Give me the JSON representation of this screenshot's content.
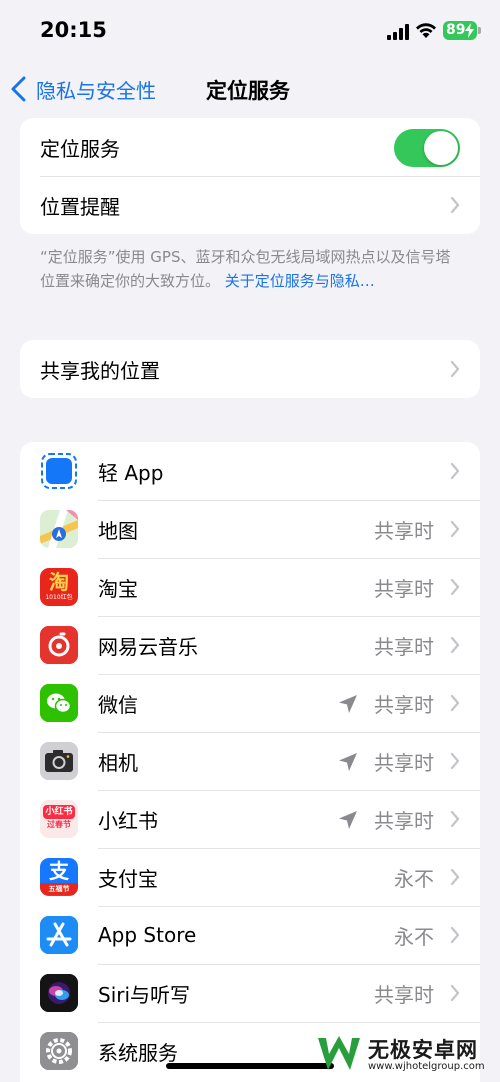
{
  "status_bar": {
    "time": "20:15",
    "battery": "89"
  },
  "nav": {
    "back_label": "隐私与安全性",
    "title": "定位服务"
  },
  "section_main": {
    "location_services_label": "定位服务",
    "location_services_on": true,
    "location_alerts_label": "位置提醒"
  },
  "footer": {
    "text": "“定位服务”使用 GPS、蓝牙和众包无线局域网热点以及信号塔位置来确定你的大致方位。",
    "link": "关于定位服务与隐私…"
  },
  "share_location_label": "共享我的位置",
  "apps": [
    {
      "name": "轻 App",
      "value": "",
      "arrow": false,
      "icon": "app-clip-icon"
    },
    {
      "name": "地图",
      "value": "共享时",
      "arrow": false,
      "icon": "maps-icon"
    },
    {
      "name": "淘宝",
      "value": "共享时",
      "arrow": false,
      "icon": "taobao-icon"
    },
    {
      "name": "网易云音乐",
      "value": "共享时",
      "arrow": false,
      "icon": "netease-music-icon"
    },
    {
      "name": "微信",
      "value": "共享时",
      "arrow": true,
      "icon": "wechat-icon"
    },
    {
      "name": "相机",
      "value": "共享时",
      "arrow": true,
      "icon": "camera-icon"
    },
    {
      "name": "小红书",
      "value": "共享时",
      "arrow": true,
      "icon": "xiaohongshu-icon"
    },
    {
      "name": "支付宝",
      "value": "永不",
      "arrow": false,
      "icon": "alipay-icon"
    },
    {
      "name": "App Store",
      "value": "永不",
      "arrow": false,
      "icon": "app-store-icon"
    },
    {
      "name": "Siri与听写",
      "value": "共享时",
      "arrow": false,
      "icon": "siri-icon"
    },
    {
      "name": "系统服务",
      "value": "",
      "arrow": false,
      "icon": "settings-gear-icon"
    }
  ],
  "icon_texts": {
    "taobao": "淘",
    "taobao_sub": "1010红包",
    "xhs": "小红书",
    "xhs_sub": "过春节",
    "alipay": "支",
    "alipay_sub": "五福节"
  },
  "watermark": {
    "brand": "无极安卓网",
    "url": "www.wjhotelgroup.com"
  },
  "colors": {
    "accent": "#1a73e8",
    "toggle_on": "#34c759",
    "battery": "#34c759"
  }
}
